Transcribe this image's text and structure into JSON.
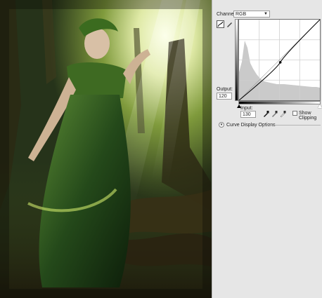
{
  "photo": {
    "description_icon": "fantasy-forest-photo"
  },
  "curves": {
    "channel_label": "Channel:",
    "channel_value": "RGB",
    "output_label": "Output:",
    "output_value": "120",
    "input_label": "Input:",
    "input_value": "130",
    "show_clipping_label": "Show Clipping",
    "curve_display_label": "Curve Display Options",
    "point": {
      "input": 130,
      "output": 120
    }
  },
  "colors": {
    "panel_bg": "#e6e6e6",
    "grid": "#cfcfcf",
    "curve": "#000000"
  }
}
